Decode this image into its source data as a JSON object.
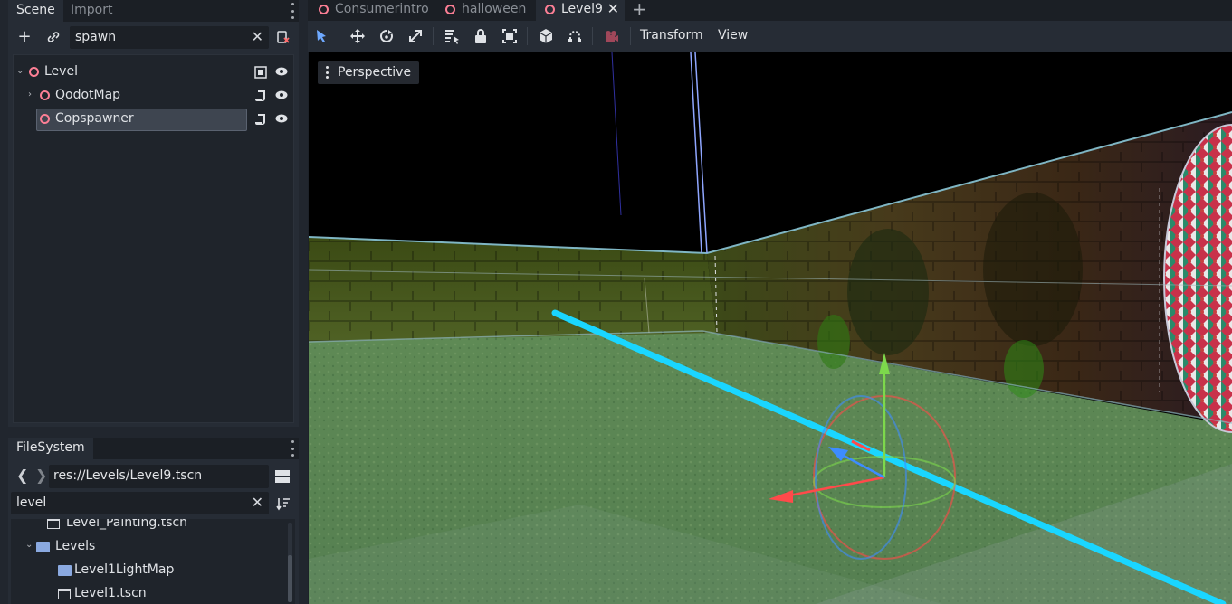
{
  "scene_dock": {
    "tabs": [
      {
        "label": "Scene",
        "active": true
      },
      {
        "label": "Import",
        "active": false
      }
    ],
    "search_value": "spawn",
    "tree": [
      {
        "label": "Level",
        "expanded": true,
        "depth": 0
      },
      {
        "label": "QodotMap",
        "expanded": false,
        "depth": 1
      },
      {
        "label": "Copspawner",
        "selected": true,
        "depth": 1
      }
    ]
  },
  "filesystem_dock": {
    "tab_label": "FileSystem",
    "path": "res://Levels/Level9.tscn",
    "filter_value": "level",
    "items": [
      {
        "label": "Level_Painting.tscn",
        "kind": "scene"
      },
      {
        "label": "Levels",
        "kind": "folder",
        "expanded": true
      },
      {
        "label": "Level1LightMap",
        "kind": "folder"
      },
      {
        "label": "Level1.tscn",
        "kind": "scene"
      }
    ]
  },
  "editor_tabs": [
    {
      "label": "Consumerintro",
      "active": false
    },
    {
      "label": "halloween",
      "active": false
    },
    {
      "label": "Level9",
      "active": true
    }
  ],
  "toolbar": {
    "transform_label": "Transform",
    "view_label": "View"
  },
  "viewport": {
    "perspective_label": "Perspective"
  },
  "colors": {
    "node_ring": "#fc7f95",
    "accent_blue": "#6ea9ff",
    "folder": "#8aa9e0",
    "gizmo_x": "#ff4a4a",
    "gizmo_y": "#7dd84c",
    "gizmo_z": "#3d8cff",
    "ray_cyan": "#1ad6ff"
  }
}
